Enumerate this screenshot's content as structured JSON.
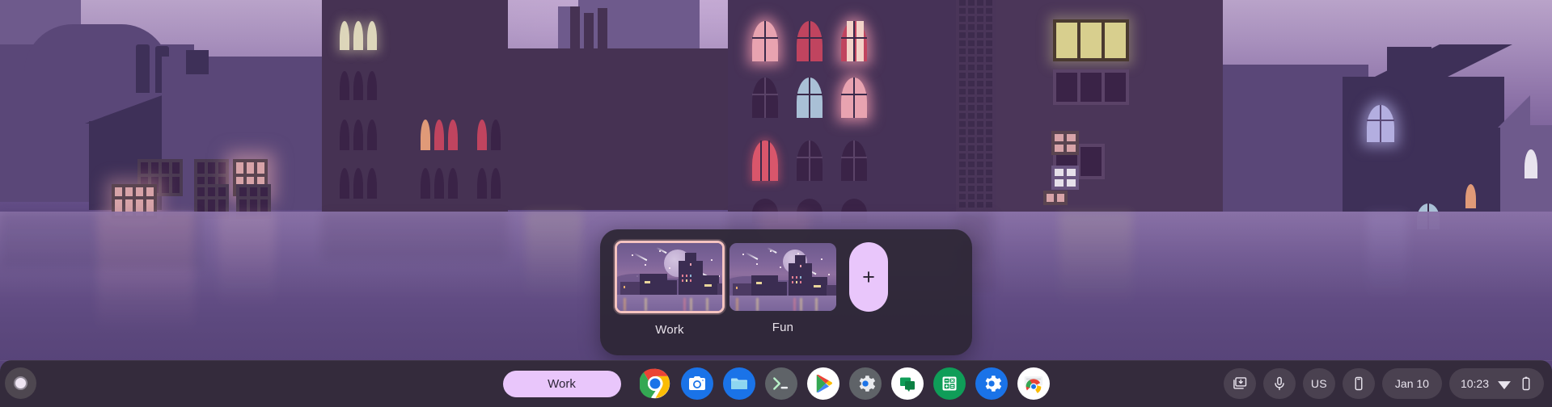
{
  "desktop": {
    "wallpaper_name": "pixel-night-city-wallpaper",
    "accent_color": "#e9c6fb",
    "shelf_color": "#342b3c",
    "selected_desk_border": "#f5c3c0"
  },
  "desk_bar": {
    "name": "desk-switcher-bar",
    "desks": [
      {
        "label": "Work",
        "active": true
      },
      {
        "label": "Fun",
        "active": false
      }
    ],
    "add_desk_label": "+"
  },
  "shelf": {
    "launcher_name": "launcher-button",
    "active_desk_pill": "Work",
    "apps": [
      {
        "name": "chrome",
        "label": "Google Chrome"
      },
      {
        "name": "camera",
        "label": "Camera"
      },
      {
        "name": "files",
        "label": "Files"
      },
      {
        "name": "terminal",
        "label": "Terminal"
      },
      {
        "name": "play-store",
        "label": "Play Store"
      },
      {
        "name": "android-settings",
        "label": "Android Settings"
      },
      {
        "name": "messages",
        "label": "Messages"
      },
      {
        "name": "calculator",
        "label": "Calculator"
      },
      {
        "name": "settings",
        "label": "Settings"
      },
      {
        "name": "chrome-canary",
        "label": "Chrome Canary"
      }
    ]
  },
  "status_area": {
    "screen_capture_label": "Screen capture",
    "microphone_label": "Microphone",
    "keyboard_layout": "US",
    "phone_hub_label": "Phone Hub",
    "date": "Jan 10",
    "time": "10:23",
    "network_label": "Wi-Fi",
    "battery_label": "Battery"
  }
}
